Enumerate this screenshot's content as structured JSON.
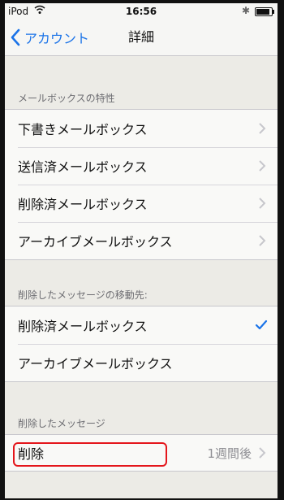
{
  "status_bar": {
    "carrier": "iPod",
    "time": "16:56",
    "battery_level": 0.9
  },
  "nav": {
    "back_label": "アカウント",
    "title": "詳細"
  },
  "mailbox_section": {
    "header": "メールボックスの特性",
    "items": [
      {
        "label": "下書きメールボックス"
      },
      {
        "label": "送信済メールボックス"
      },
      {
        "label": "削除済メールボックス"
      },
      {
        "label": "アーカイブメールボックス"
      }
    ]
  },
  "move_section": {
    "header": "削除したメッセージの移動先:",
    "items": [
      {
        "label": "削除済メールボックス",
        "selected": true
      },
      {
        "label": "アーカイブメールボックス",
        "selected": false
      }
    ]
  },
  "deleted_section": {
    "header": "削除したメッセージ",
    "items": [
      {
        "label": "削除",
        "value": "1週間後"
      }
    ]
  },
  "colors": {
    "accent": "#1a73e8",
    "highlight": "#e4161b"
  },
  "icons": [
    "wifi-icon",
    "bluetooth-icon",
    "battery-icon",
    "back-chevron-icon",
    "chevron-right-icon",
    "checkmark-icon"
  ]
}
